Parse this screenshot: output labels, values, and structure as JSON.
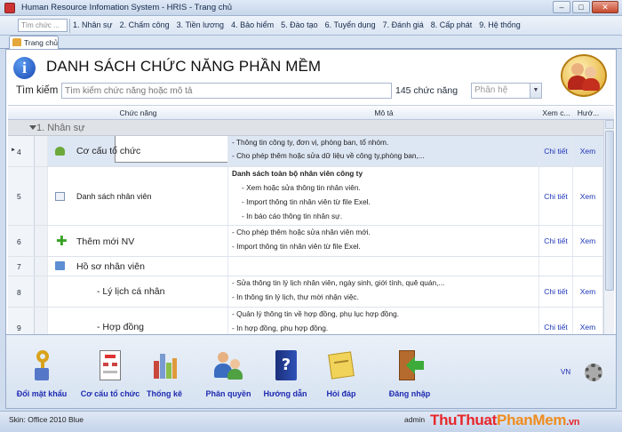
{
  "window": {
    "title": "Human Resource Infomation System - HRIS - Trang chủ",
    "min": "–",
    "max": "□",
    "close": "✕"
  },
  "menu": {
    "search_placeholder": "Tìm chức ...",
    "items": [
      "1. Nhân sự",
      "2. Chấm công",
      "3. Tiền lương",
      "4. Bảo hiểm",
      "5. Đào tạo",
      "6. Tuyển dụng",
      "7. Đánh giá",
      "8. Cấp phát",
      "9. Hệ thống"
    ]
  },
  "tabs": {
    "home": "Trang chủ"
  },
  "header": {
    "info": "i",
    "title": "DANH SÁCH CHỨC NĂNG PHẦN MỀM"
  },
  "search": {
    "label": "Tìm kiếm",
    "placeholder": "Tìm kiếm chức năng hoặc mô tả",
    "count": "145 chức năng",
    "filter_placeholder": "Phân hệ"
  },
  "grid": {
    "columns": {
      "function": "Chức năng",
      "desc": "Mô tả",
      "view": "Xem c...",
      "guide": "Hướ..."
    },
    "group": "1. Nhân sự",
    "rows": [
      {
        "num": "4",
        "name": "Cơ cấu tổ chức",
        "desc": [
          "- Thông tin công ty, đơn vị, phòng ban, tổ nhóm.",
          "- Cho phép thêm hoặc sửa dữ liệu về công ty,phòng ban,..."
        ],
        "view": "Chi tiết",
        "guide": "Xem"
      },
      {
        "num": "5",
        "name": "Danh sách nhân viên",
        "desc": [
          "Danh sách toàn bộ nhân viên công ty",
          "- Xem hoặc sửa thông tin nhân viên.",
          "- Import thông tin nhân viên từ file Exel.",
          "- In báo cáo thông tin nhân sự."
        ],
        "view": "Chi tiết",
        "guide": "Xem"
      },
      {
        "num": "6",
        "name": "Thêm mới NV",
        "desc": [
          "- Cho phép thêm hoặc sửa nhân viên mới.",
          "- Import thông tin nhân viên từ file Exel."
        ],
        "view": "Chi tiết",
        "guide": "Xem"
      },
      {
        "num": "7",
        "name": "Hồ sơ nhân viên",
        "desc": [],
        "view": "",
        "guide": ""
      },
      {
        "num": "8",
        "name": "- Lý lịch cá nhân",
        "desc": [
          "- Sửa thông tin lý lịch nhân viên, ngày sinh, giới tính, quê quán,...",
          "- In thông tin lý lịch, thư mời nhận việc."
        ],
        "view": "Chi tiết",
        "guide": "Xem"
      },
      {
        "num": "9",
        "name": "- Hợp đồng",
        "desc": [
          "- Quản lý thông tin về hợp đồng, phụ lục hợp đồng.",
          "- In hợp đồng, phụ hợp đồng."
        ],
        "view": "Chi tiết",
        "guide": "Xem"
      }
    ]
  },
  "toolbar": {
    "items": [
      "Đổi mật khẩu",
      "Cơ cấu tổ chức",
      "Thống kê",
      "Phân quyền",
      "Hướng dẫn",
      "Hỏi đáp",
      "Đăng nhập"
    ],
    "lang": "VN"
  },
  "status": {
    "skin": "Skin: Office 2010 Blue",
    "user": "admin"
  },
  "watermark": {
    "part1": "ThuThuat",
    "part2": "PhanMem",
    ".vn": ".vn"
  }
}
